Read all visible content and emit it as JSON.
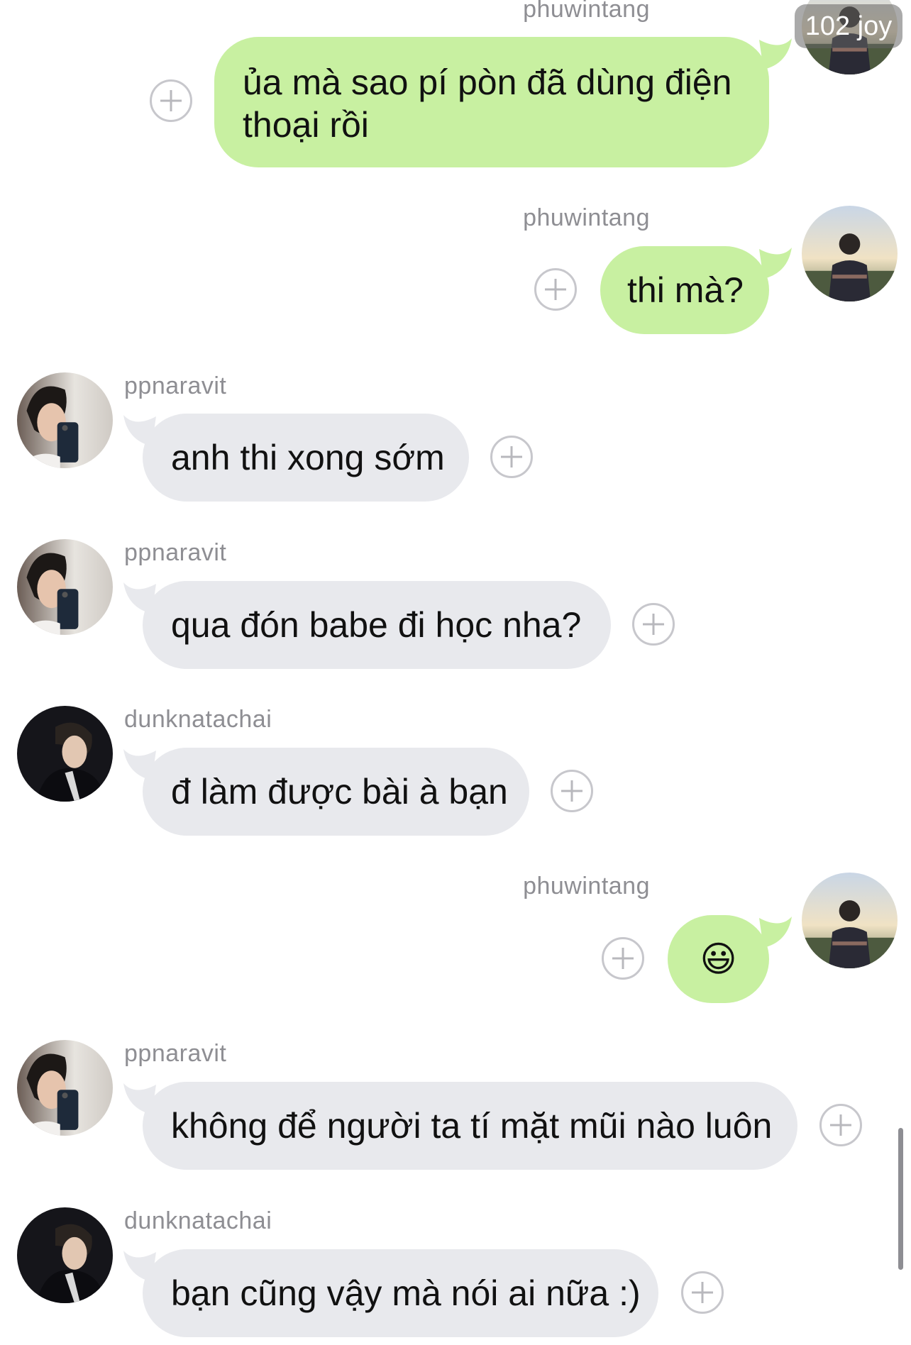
{
  "messages": [
    {
      "side": "right",
      "user": "phuwintang",
      "lines": [
        "ủa mà sao pí pòn đã dùng điện",
        "thoại rồi"
      ]
    },
    {
      "side": "right",
      "user": "phuwintang",
      "lines": [
        "thi mà?"
      ]
    },
    {
      "side": "left",
      "user": "ppnaravit",
      "lines": [
        "anh thi xong sớm"
      ]
    },
    {
      "side": "left",
      "user": "ppnaravit",
      "lines": [
        "qua đón babe đi học nha?"
      ]
    },
    {
      "side": "left",
      "user": "dunknatachai",
      "lines": [
        "đ làm được bài à bạn"
      ]
    },
    {
      "side": "right",
      "user": "phuwintang",
      "lines": [
        "😃"
      ]
    },
    {
      "side": "left",
      "user": "ppnaravit",
      "lines": [
        "không để người ta tí mặt mũi nào luôn"
      ]
    },
    {
      "side": "left",
      "user": "dunknatachai",
      "lines": [
        "bạn cũng vậy mà nói ai nữa :)"
      ]
    }
  ],
  "overlay_badge": "102 joy",
  "colors": {
    "sent_bubble": "#c8f0a1",
    "received_bubble": "#e8e9ed",
    "username": "#8e8e93"
  }
}
